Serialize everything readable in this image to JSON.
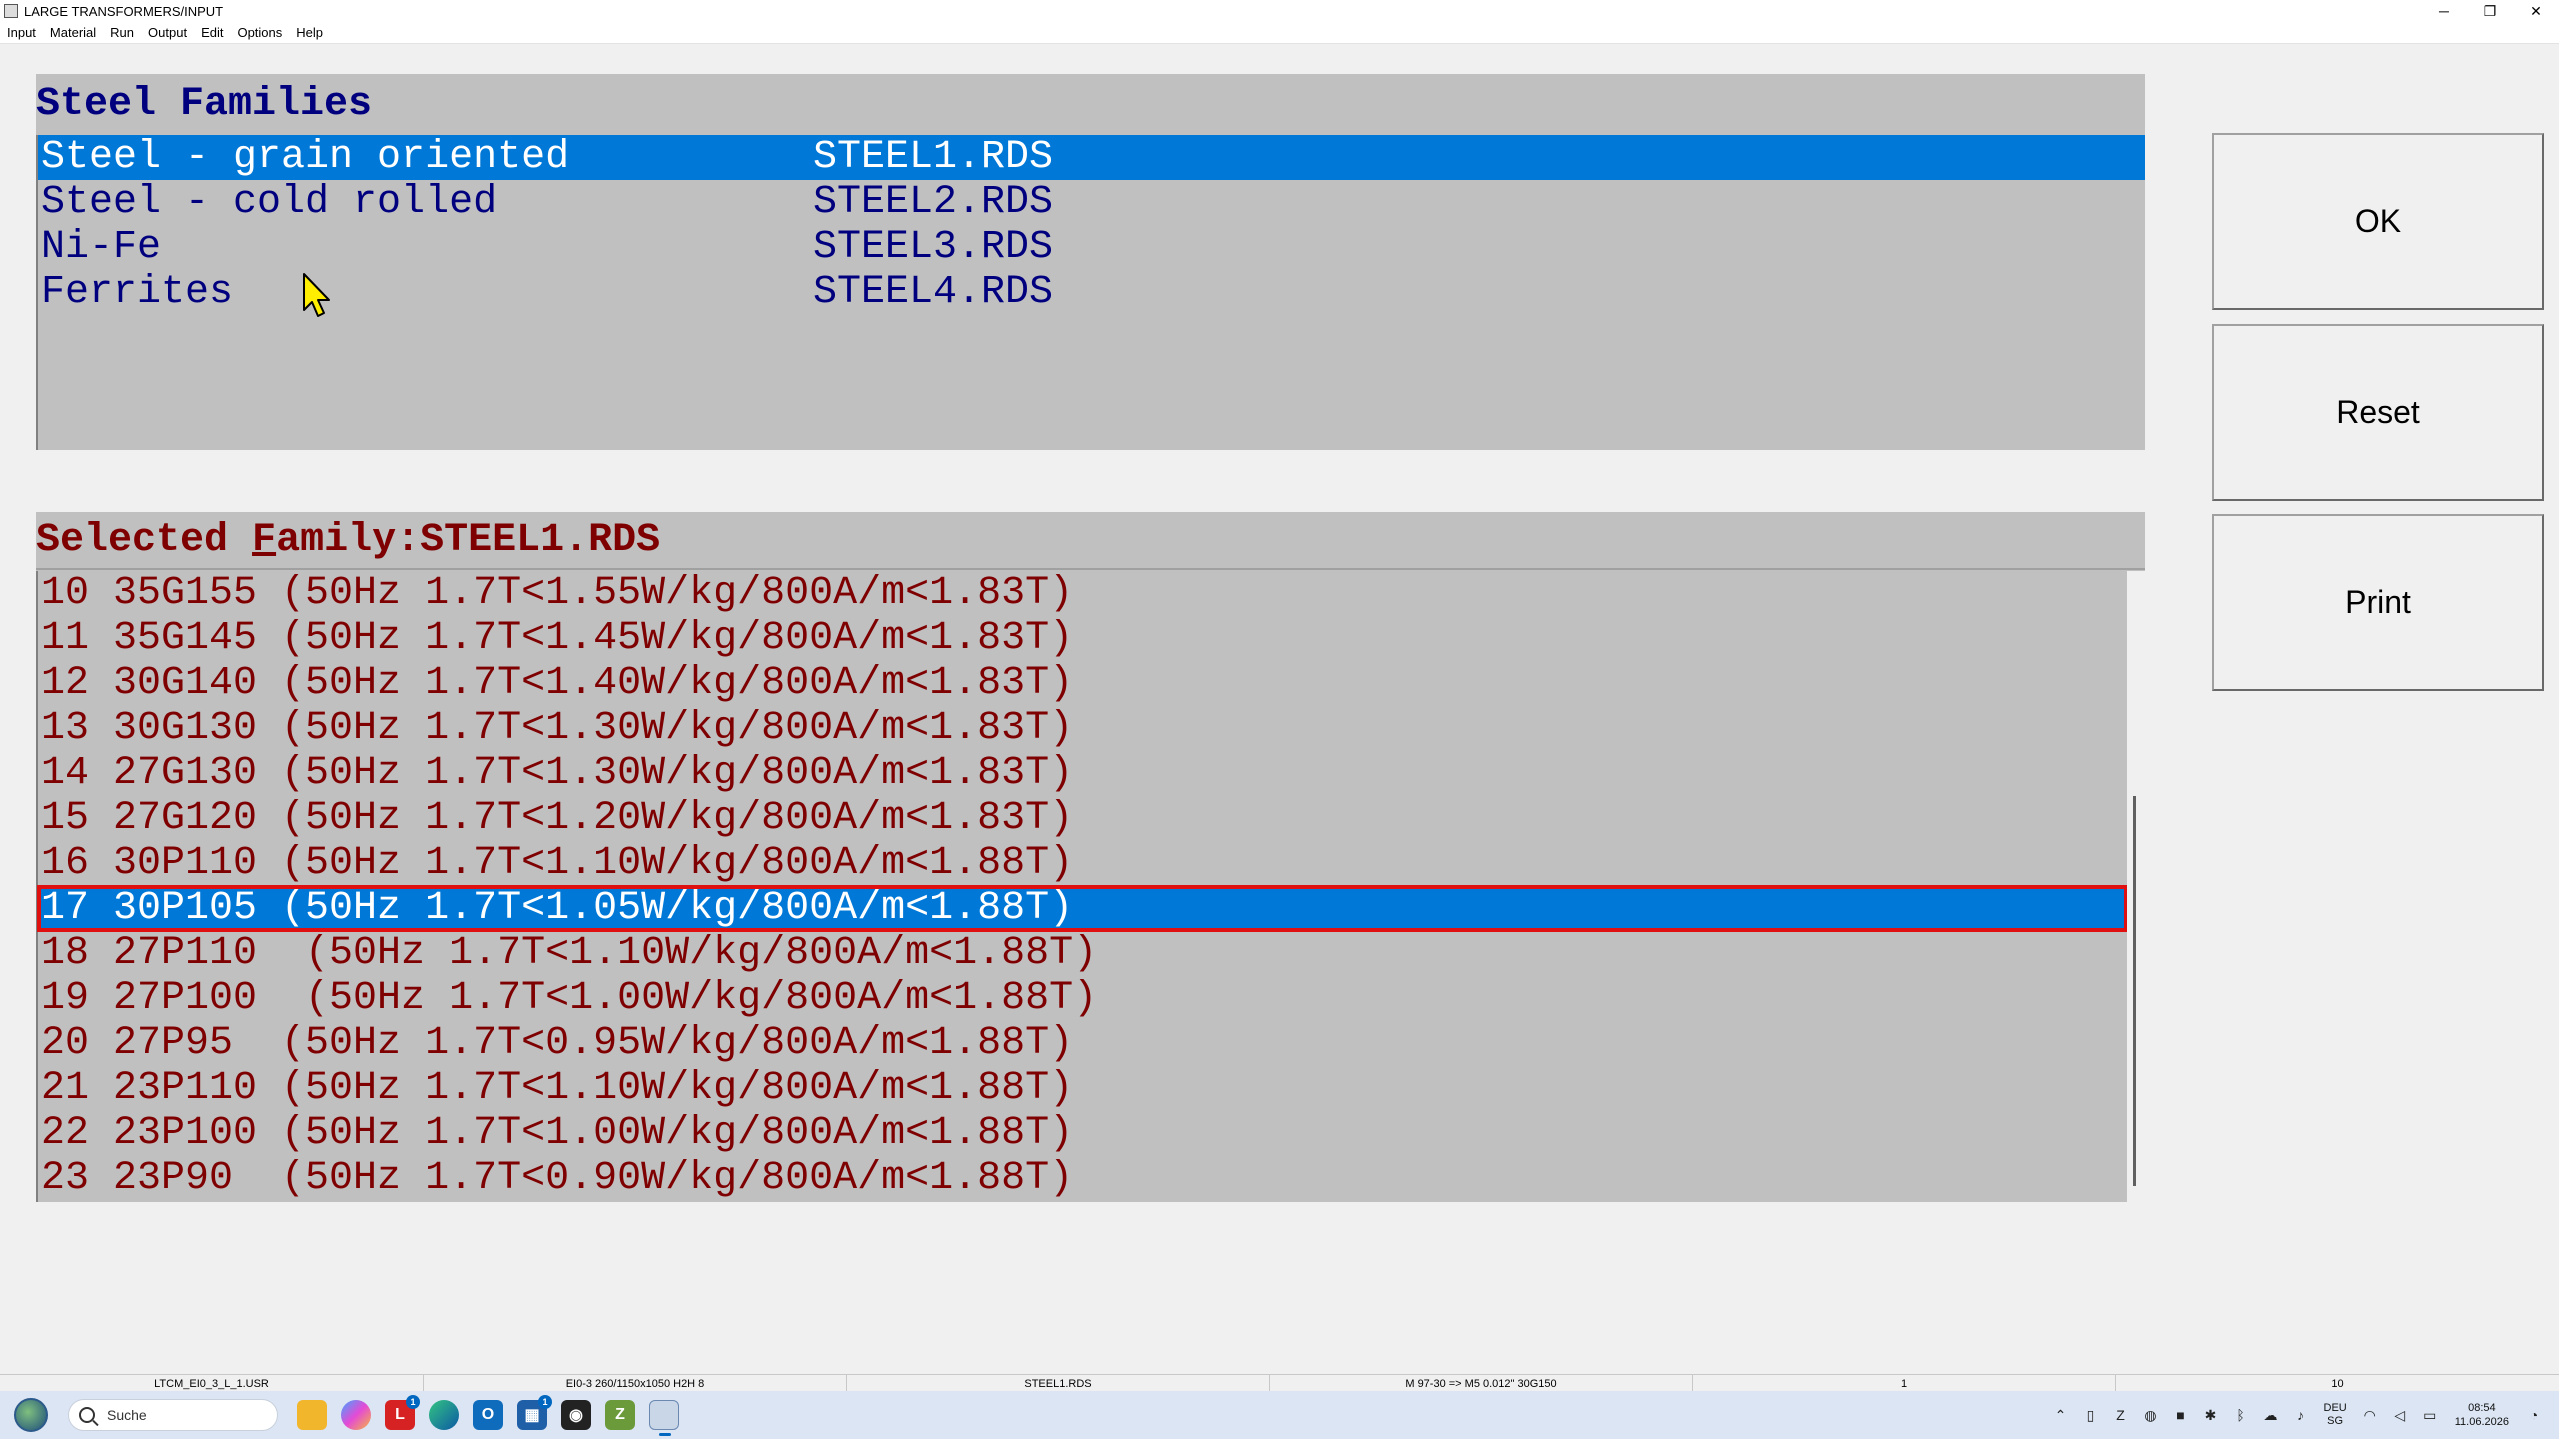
{
  "window": {
    "title": "LARGE TRANSFORMERS/INPUT",
    "controls": {
      "minimize": "─",
      "restore": "❐",
      "close": "✕"
    }
  },
  "menu": [
    "Input",
    "Material",
    "Run",
    "Output",
    "Edit",
    "Options",
    "Help"
  ],
  "families": {
    "header": "Steel Families",
    "items": [
      {
        "name": "Steel - grain oriented",
        "file": "STEEL1.RDS",
        "selected": true
      },
      {
        "name": "Steel - cold rolled",
        "file": "STEEL2.RDS",
        "selected": false
      },
      {
        "name": "Ni-Fe",
        "file": "STEEL3.RDS",
        "selected": false
      },
      {
        "name": "Ferrites",
        "file": "STEEL4.RDS",
        "selected": false
      }
    ]
  },
  "selected_family": {
    "header_prefix": "Selected ",
    "header_underlined": "F",
    "header_rest": "amily:STEEL1.RDS",
    "items": [
      {
        "text": "10 35G155 (50Hz 1.7T<1.55W/kg/800A/m<1.83T)",
        "selected": false
      },
      {
        "text": "11 35G145 (50Hz 1.7T<1.45W/kg/800A/m<1.83T)",
        "selected": false
      },
      {
        "text": "12 30G140 (50Hz 1.7T<1.40W/kg/800A/m<1.83T)",
        "selected": false
      },
      {
        "text": "13 30G130 (50Hz 1.7T<1.30W/kg/800A/m<1.83T)",
        "selected": false
      },
      {
        "text": "14 27G130 (50Hz 1.7T<1.30W/kg/800A/m<1.83T)",
        "selected": false
      },
      {
        "text": "15 27G120 (50Hz 1.7T<1.20W/kg/800A/m<1.83T)",
        "selected": false
      },
      {
        "text": "16 30P110 (50Hz 1.7T<1.10W/kg/800A/m<1.88T)",
        "selected": false
      },
      {
        "text": "17 30P105 (50Hz 1.7T<1.05W/kg/800A/m<1.88T)",
        "selected": true
      },
      {
        "text": "18 27P110  (50Hz 1.7T<1.10W/kg/800A/m<1.88T)",
        "selected": false
      },
      {
        "text": "19 27P100  (50Hz 1.7T<1.00W/kg/800A/m<1.88T)",
        "selected": false
      },
      {
        "text": "20 27P95  (50Hz 1.7T<0.95W/kg/800A/m<1.88T)",
        "selected": false
      },
      {
        "text": "21 23P110 (50Hz 1.7T<1.10W/kg/800A/m<1.88T)",
        "selected": false
      },
      {
        "text": "22 23P100 (50Hz 1.7T<1.00W/kg/800A/m<1.88T)",
        "selected": false
      },
      {
        "text": "23 23P90  (50Hz 1.7T<0.90W/kg/800A/m<1.88T)",
        "selected": false
      }
    ]
  },
  "buttons": {
    "ok": {
      "mnemonic": "O",
      "rest": "K"
    },
    "reset": {
      "mnemonic": "R",
      "rest": "eset"
    },
    "print": {
      "mnemonic": "P",
      "rest": "rint"
    }
  },
  "statusbar": [
    "LTCM_EI0_3_L_1.USR",
    "EI0-3 260/1150x1050 H2H 8",
    "STEEL1.RDS",
    "M 97-30 => M5 0.012\" 30G150",
    "1",
    "10"
  ],
  "taskbar": {
    "search_placeholder": "Suche",
    "language": {
      "code": "DEU",
      "region": "SG"
    },
    "clock": {
      "time": "08:54",
      "date": "11.06.2026"
    },
    "badges": {
      "app_l": "1",
      "app_store": "1"
    }
  },
  "colors": {
    "selection": "#0078d7",
    "families_text": "#00007f",
    "grades_text": "#7f0000",
    "highlight_outline": "#e01010"
  }
}
